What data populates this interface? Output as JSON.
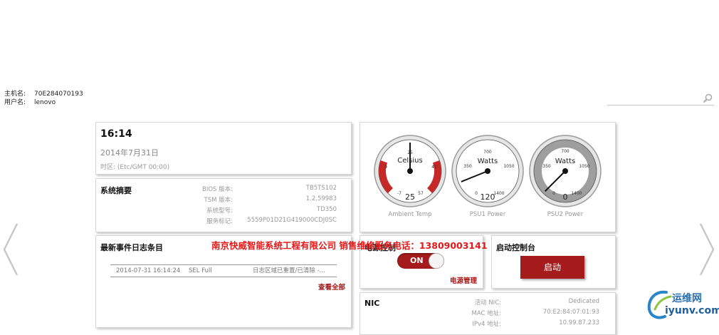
{
  "host": {
    "hostname_label": "主机名:",
    "hostname_value": "70E284070193",
    "user_label": "用户名:",
    "user_value": "lenovo"
  },
  "search": {
    "icon": "search-icon"
  },
  "nav": {
    "prev_icon": "chevron-left-icon",
    "next_icon": "chevron-right-icon"
  },
  "time_card": {
    "time": "16:14",
    "date": "2014年7月31日",
    "timezone": "时区: (Etc/GMT 00:00)"
  },
  "summary": {
    "title": "系统摘要",
    "rows": [
      {
        "label": "BIOS 版本:",
        "value": "TB5TS102"
      },
      {
        "label": "TSM 版本:",
        "value": "1.2.59983"
      },
      {
        "label": "系统型号:",
        "value": "TD350"
      },
      {
        "label": "服务标记:",
        "value": "5559P01D21G419000CDJ0SC"
      }
    ]
  },
  "gauges": [
    {
      "unit": "Celsius",
      "value": "25",
      "min": "-7",
      "max": "57",
      "ticks": [
        "9",
        "25",
        "41"
      ],
      "label": "Ambient Temp",
      "reading": 25,
      "range": [
        -7,
        57
      ]
    },
    {
      "unit": "Watts",
      "value": "120",
      "min": "0",
      "max": "1400",
      "ticks": [
        "350",
        "700",
        "1050"
      ],
      "label": "PSU1 Power",
      "reading": 120,
      "range": [
        0,
        1400
      ]
    },
    {
      "unit": "Watts",
      "value": "0",
      "min": "0",
      "max": "1400",
      "ticks": [
        "350",
        "700",
        "1050"
      ],
      "label": "PSU2 Power",
      "reading": 0,
      "range": [
        0,
        1400
      ]
    }
  ],
  "events": {
    "title": "最新事件日志条目",
    "rows": [
      {
        "timestamp": "2014-07-31 16:14:24",
        "type": "SEL Full",
        "message": "日志区域已重置/已清除 -..."
      }
    ],
    "view_all": "查看全部"
  },
  "banner": "南京快威智能系统工程有限公司 销售维修服务电话：13809003141",
  "power": {
    "title": "电源控制",
    "toggle_label": "ON",
    "link": "电源管理"
  },
  "console": {
    "title": "启动控制台",
    "button": "启动"
  },
  "nic": {
    "title": "NIC",
    "rows": [
      {
        "label": "活动 NIC:",
        "value": "Dedicated"
      },
      {
        "label": "MAC 地址:",
        "value": "70:E2:84:07:01:93"
      },
      {
        "label": "IPv4 地址:",
        "value": "10.99.87.233"
      }
    ]
  },
  "watermark": {
    "cn": "运维网",
    "en": "iyunv.com"
  },
  "colors": {
    "accent": "#a51b1b",
    "banner": "#e41818",
    "gauge_red": "#c62828",
    "gauge_gray": "#9e9e9e"
  }
}
